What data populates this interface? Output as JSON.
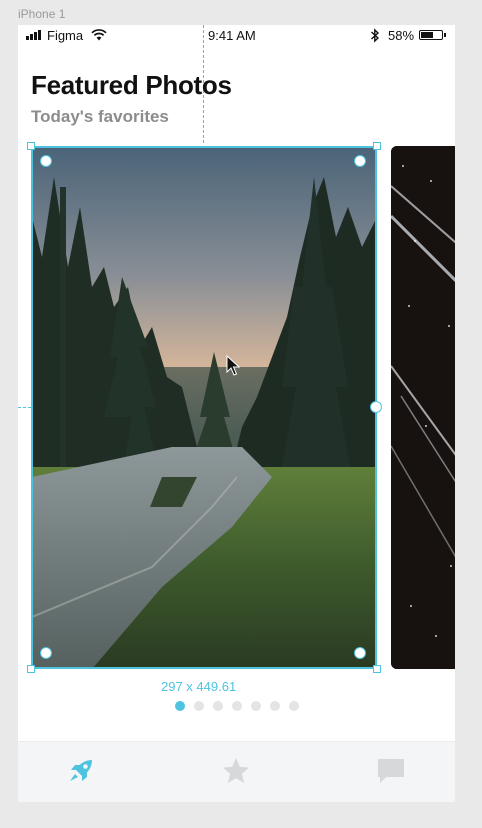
{
  "frame": {
    "label": "iPhone 1"
  },
  "status_bar": {
    "carrier": "Figma",
    "time": "9:41 AM",
    "battery": "58%",
    "battery_level": 0.58
  },
  "header": {
    "title": "Featured Photos",
    "subtitle": "Today's favorites"
  },
  "selection": {
    "dimensions": "297 x 449.61",
    "accent_color": "#4ec3e0"
  },
  "pager": {
    "count": 7,
    "active_index": 0
  },
  "tabs": [
    {
      "name": "rocket-icon",
      "active": true
    },
    {
      "name": "star-icon",
      "active": false
    },
    {
      "name": "chat-icon",
      "active": false
    }
  ]
}
